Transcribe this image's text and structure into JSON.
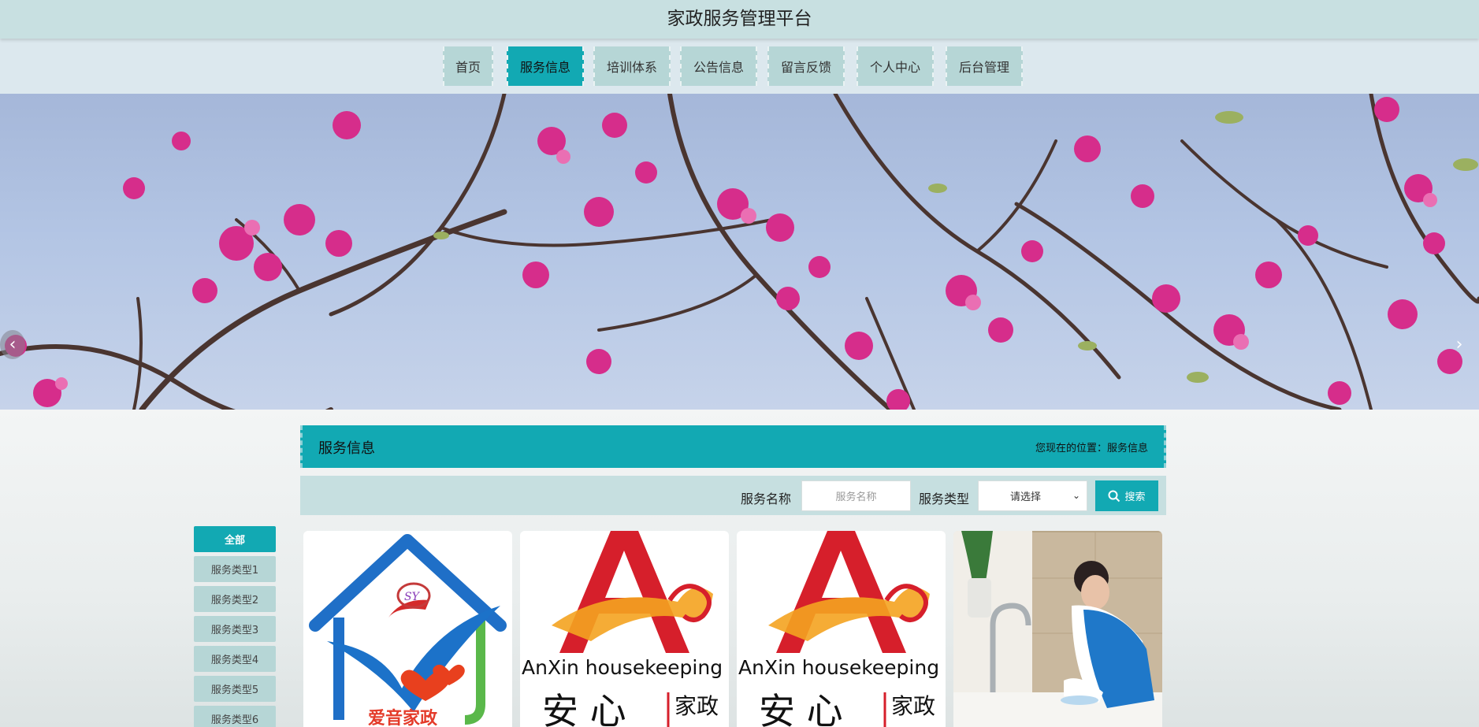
{
  "header": {
    "title": "家政服务管理平台"
  },
  "nav": {
    "items": [
      {
        "label": "首页"
      },
      {
        "label": "服务信息"
      },
      {
        "label": "培训体系"
      },
      {
        "label": "公告信息"
      },
      {
        "label": "留言反馈"
      },
      {
        "label": "个人中心"
      },
      {
        "label": "后台管理"
      }
    ],
    "active_index": 1
  },
  "banner": {
    "prev": "‹",
    "next": "›"
  },
  "section": {
    "title": "服务信息",
    "breadcrumb": "您现在的位置：服务信息"
  },
  "search": {
    "name_label": "服务名称",
    "name_placeholder": "服务名称",
    "type_label": "服务类型",
    "type_selected": "请选择",
    "button_label": "搜索"
  },
  "categories": [
    {
      "label": "全部"
    },
    {
      "label": "服务类型1"
    },
    {
      "label": "服务类型2"
    },
    {
      "label": "服务类型3"
    },
    {
      "label": "服务类型4"
    },
    {
      "label": "服务类型5"
    },
    {
      "label": "服务类型6"
    }
  ],
  "cards": [
    {
      "image": "aiyi-jiazheng-logo",
      "logo_text": "爱音家政"
    },
    {
      "image": "anxin-housekeeping-logo",
      "logo_text": "AnXin housekeeping",
      "logo_cn": "安 心",
      "logo_cn2": "家政"
    },
    {
      "image": "anxin-housekeeping-logo",
      "logo_text": "AnXin housekeeping",
      "logo_cn": "安 心",
      "logo_cn2": "家政"
    },
    {
      "image": "cleaning-worker-photo"
    }
  ],
  "colors": {
    "accent": "#12a9b3",
    "header_bg": "#c8e0e1",
    "nav_bg": "#dce8ee",
    "tab_bg": "#b6d6d6"
  }
}
